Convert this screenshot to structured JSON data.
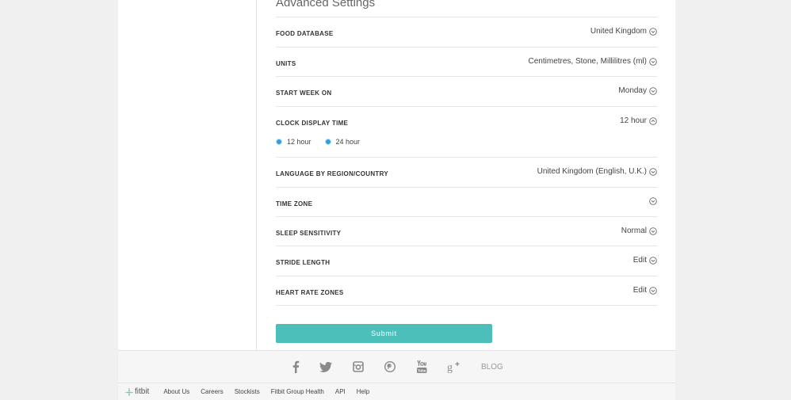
{
  "section": {
    "title": "Advanced Settings"
  },
  "settings": [
    {
      "label": "FOOD DATABASE",
      "value": "United Kingdom"
    },
    {
      "label": "UNITS",
      "value": "Centimetres, Stone, Millilitres (ml)"
    },
    {
      "label": "START WEEK ON",
      "value": "Monday"
    },
    {
      "label": "CLOCK DISPLAY TIME",
      "value": "12 hour"
    },
    {
      "label": "LANGUAGE BY REGION/COUNTRY",
      "value": "United Kingdom (English, U.K.)"
    },
    {
      "label": "TIME ZONE",
      "value": ""
    },
    {
      "label": "SLEEP SENSITIVITY",
      "value": "Normal"
    },
    {
      "label": "STRIDE LENGTH",
      "value": "Edit"
    },
    {
      "label": "HEART RATE ZONES",
      "value": "Edit"
    }
  ],
  "clock_options": [
    "12 hour",
    "24 hour"
  ],
  "submit_label": "Submit",
  "social": {
    "icons": [
      "facebook-icon",
      "twitter-icon",
      "instagram-icon",
      "pinterest-icon",
      "youtube-icon",
      "google-plus-icon"
    ],
    "blog_label": "BLOG"
  },
  "footer": {
    "logo_text": "fitbit",
    "links": [
      "About Us",
      "Careers",
      "Stockists",
      "Fitbit Group Health",
      "API",
      "Help"
    ]
  },
  "colors": {
    "accent": "#4cbfbb",
    "radio": "#2d9fd9"
  }
}
